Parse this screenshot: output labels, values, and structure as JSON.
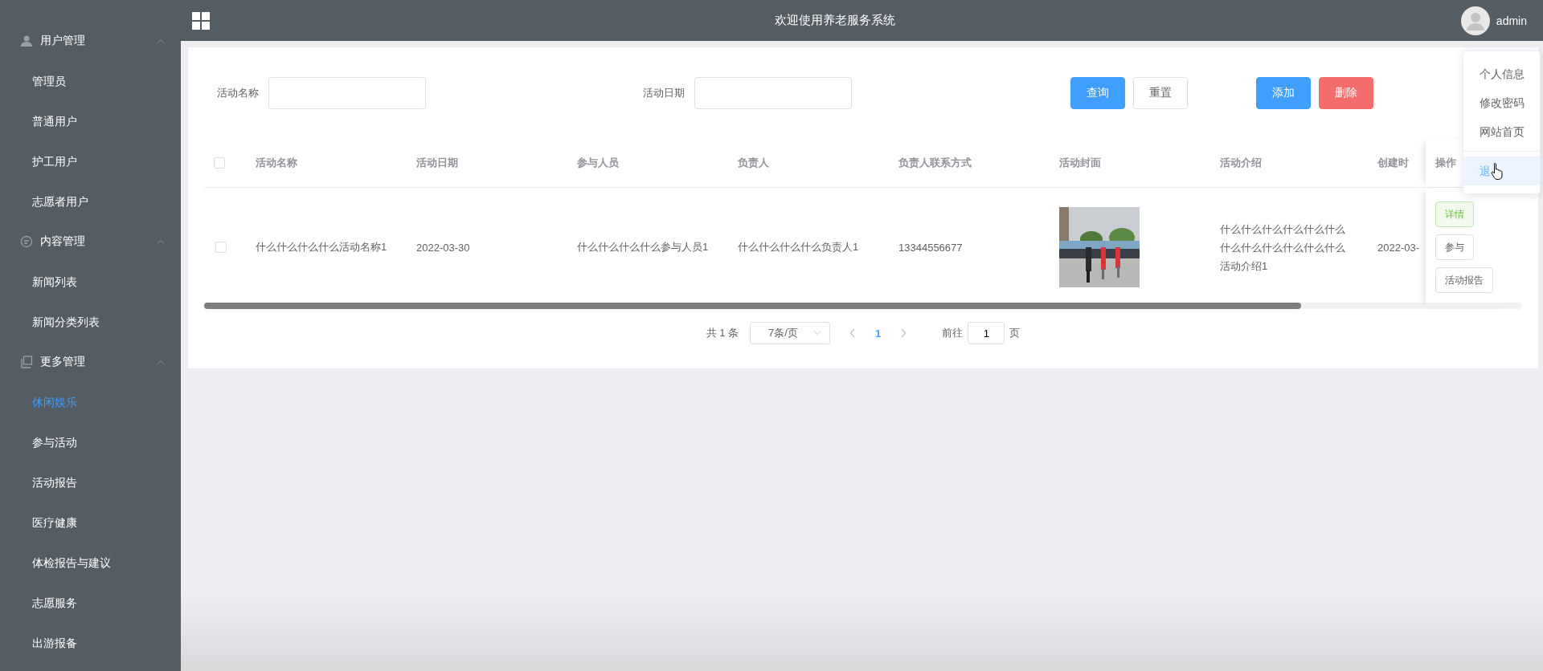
{
  "sidebar": {
    "groups": [
      {
        "title": "用户管理",
        "expanded": true,
        "items": [
          {
            "label": "管理员",
            "selected": false
          },
          {
            "label": "普通用户",
            "selected": false
          },
          {
            "label": "护工用户",
            "selected": false
          },
          {
            "label": "志愿者用户",
            "selected": false
          }
        ]
      },
      {
        "title": "内容管理",
        "expanded": true,
        "items": [
          {
            "label": "新闻列表",
            "selected": false
          },
          {
            "label": "新闻分类列表",
            "selected": false
          }
        ]
      },
      {
        "title": "更多管理",
        "expanded": true,
        "items": [
          {
            "label": "休闲娱乐",
            "selected": true
          },
          {
            "label": "参与活动",
            "selected": false
          },
          {
            "label": "活动报告",
            "selected": false
          },
          {
            "label": "医疗健康",
            "selected": false
          },
          {
            "label": "体检报告与建议",
            "selected": false
          },
          {
            "label": "志愿服务",
            "selected": false
          },
          {
            "label": "出游报备",
            "selected": false
          }
        ]
      }
    ]
  },
  "header": {
    "title": "欢迎使用养老服务系统",
    "user": "admin"
  },
  "user_menu": {
    "items": [
      {
        "label": "个人信息",
        "selected": false
      },
      {
        "label": "修改密码",
        "selected": false
      },
      {
        "label": "网站首页",
        "selected": false
      },
      {
        "label": "退",
        "selected": true
      }
    ]
  },
  "search": {
    "fields": [
      {
        "label": "活动名称"
      },
      {
        "label": "活动日期"
      }
    ],
    "buttons": [
      {
        "label": "查询",
        "kind": "primary"
      },
      {
        "label": "重置",
        "kind": "default"
      }
    ],
    "actions": [
      {
        "label": "添加",
        "kind": "primary"
      },
      {
        "label": "删除",
        "kind": "danger"
      }
    ]
  },
  "table": {
    "select_all": {
      "checked": false
    },
    "columns": [
      "活动名称",
      "活动日期",
      "参与人员",
      "负责人",
      "负责人联系方式",
      "活动封面",
      "活动介绍",
      "创建时",
      "操作"
    ],
    "rows": [
      {
        "checked": false,
        "name": "什么什么什么什么活动名称1",
        "date": "2022-03-30",
        "participants": "什么什么什么什么参与人员1",
        "leader": "什么什么什么什么负责人1",
        "phone": "13344556677",
        "cover": {
          "kind": "picture"
        },
        "intro": "什么什么什么什么什么什么什么什么什么什么什么什么活动介绍1",
        "created": "2022-03-",
        "actions": [
          {
            "label": "详情",
            "kind": "success"
          },
          {
            "label": "参与",
            "kind": "default"
          },
          {
            "label": "活动报告",
            "kind": "default"
          }
        ]
      }
    ]
  },
  "pagination": {
    "total": "共 1 条",
    "page_size": "7条/页",
    "pages": [
      {
        "label": "1",
        "selected": true
      }
    ],
    "goto_label": "前往",
    "goto_value": "1",
    "goto_suffix": "页"
  }
}
